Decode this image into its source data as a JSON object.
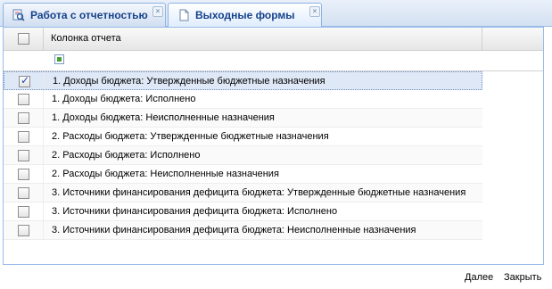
{
  "tabs": [
    {
      "label": "Работа с отчетностью",
      "active": false,
      "icon": "report-search-icon"
    },
    {
      "label": "Выходные формы",
      "active": true,
      "icon": "document-icon"
    }
  ],
  "grid": {
    "column_header": "Колонка отчета",
    "rows": [
      {
        "label": "1. Доходы бюджета: Утвержденные бюджетные назначения",
        "checked": true
      },
      {
        "label": "1. Доходы бюджета: Исполнено",
        "checked": false
      },
      {
        "label": "1. Доходы бюджета: Неисполненные назначения",
        "checked": false
      },
      {
        "label": "2. Расходы бюджета: Утвержденные бюджетные назначения",
        "checked": false
      },
      {
        "label": "2. Расходы бюджета: Исполнено",
        "checked": false
      },
      {
        "label": "2. Расходы бюджета: Неисполненные назначения",
        "checked": false
      },
      {
        "label": "3. Источники финансирования дефицита бюджета: Утвержденные бюджетные назначения",
        "checked": false
      },
      {
        "label": "3. Источники финансирования дефицита бюджета: Исполнено",
        "checked": false
      },
      {
        "label": "3. Источники финансирования дефицита бюджета: Неисполненные назначения",
        "checked": false
      }
    ]
  },
  "footer": {
    "next_label": "Далее",
    "close_label": "Закрыть"
  },
  "colors": {
    "accent": "#15428b",
    "selected_row": "#dfe8f6",
    "border": "#99bbe8"
  }
}
